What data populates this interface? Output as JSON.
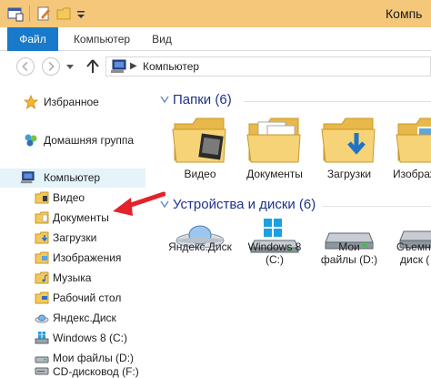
{
  "window": {
    "title": "Компь"
  },
  "ribbon": {
    "tabs": [
      "Файл",
      "Компьютер",
      "Вид"
    ]
  },
  "address": {
    "segment": "Компьютер"
  },
  "nav_pane": {
    "items": [
      {
        "label": "Избранное",
        "icon": "star-icon"
      },
      {
        "label": "Домашняя группа",
        "icon": "homegroup-icon"
      },
      {
        "label": "Компьютер",
        "icon": "computer-icon"
      },
      {
        "label": "Видео",
        "icon": "video-folder-icon"
      },
      {
        "label": "Документы",
        "icon": "documents-folder-icon"
      },
      {
        "label": "Загрузки",
        "icon": "downloads-folder-icon"
      },
      {
        "label": "Изображения",
        "icon": "pictures-folder-icon"
      },
      {
        "label": "Музыка",
        "icon": "music-folder-icon"
      },
      {
        "label": "Рабочий стол",
        "icon": "desktop-folder-icon"
      },
      {
        "label": "Яндекс.Диск",
        "icon": "yandex-disk-icon"
      },
      {
        "label": "Windows 8 (C:)",
        "icon": "windows-drive-icon"
      },
      {
        "label": "Мои файлы (D:)",
        "icon": "hard-drive-icon"
      },
      {
        "label": "CD-дисковод (F:)",
        "icon": "cd-drive-icon"
      }
    ]
  },
  "content": {
    "folders_header": "Папки (6)",
    "folders": [
      {
        "label": "Видео",
        "icon": "video-folder-icon"
      },
      {
        "label": "Документы",
        "icon": "documents-folder-icon"
      },
      {
        "label": "Загрузки",
        "icon": "downloads-folder-icon"
      },
      {
        "label": "Изображ",
        "icon": "pictures-folder-icon"
      }
    ],
    "devices_header": "Устройства и диски (6)",
    "devices": [
      {
        "label_1": "Яндекс.Диск",
        "label_2": "",
        "icon": "yandex-disk-icon"
      },
      {
        "label_1": "Windows 8",
        "label_2": "(C:)",
        "icon": "windows-drive-icon"
      },
      {
        "label_1": "Мои",
        "label_2": "файлы (D:)",
        "icon": "hard-drive-icon"
      },
      {
        "label_1": "Съемн",
        "label_2": "диск (",
        "icon": "removable-drive-icon"
      }
    ]
  },
  "colors": {
    "titlebar": "#f4c77b",
    "file_tab": "#1979ca",
    "group_header": "#1e3287",
    "annotation_arrow": "#e3232b",
    "folder_yellow": "#f3c95b"
  }
}
